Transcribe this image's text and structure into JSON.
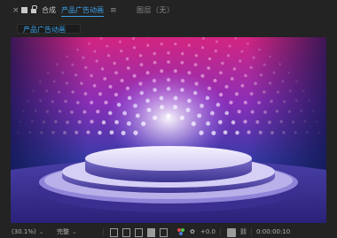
{
  "topbar": {
    "close_glyph": "×",
    "comp_label": "合成",
    "comp_name": "产品广告动画",
    "menu_glyph": "≡",
    "layer_label": "图层（无）"
  },
  "subtab": {
    "label": "产品广告动画"
  },
  "viewer": {
    "content": "stage-podium-with-light-dots",
    "colors": {
      "top": "#e02a8a",
      "mid": "#7a3fc4",
      "bottom": "#1c2a78",
      "podium": "#e8e4f8"
    }
  },
  "bottombar": {
    "zoom": "(30.1%)",
    "resolution": "完整",
    "exposure": "+0.0",
    "timecode": "0:00:00:10",
    "icons": [
      "grid-icon",
      "safe-area-icon",
      "mask-icon",
      "transparency-icon",
      "region-icon",
      "color-channel-icon",
      "exposure-icon",
      "camera-icon",
      "link-icon"
    ]
  }
}
